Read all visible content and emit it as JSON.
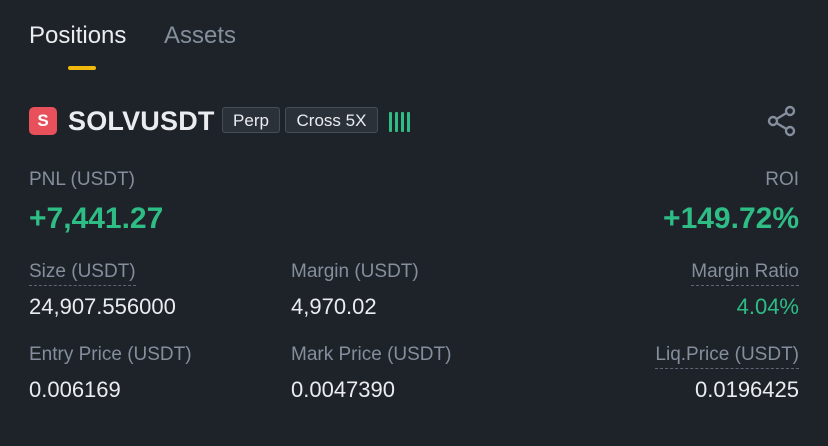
{
  "tabs": {
    "positions": "Positions",
    "assets": "Assets"
  },
  "position": {
    "logo_letter": "S",
    "symbol": "SOLVUSDT",
    "type_tag": "Perp",
    "margin_tag": "Cross 5X",
    "logo_color": "#e8505b",
    "accent_up": "#2ebd85",
    "tab_indicator_color": "#f0b90b",
    "share_icon": "share-icon",
    "signal_icon": "signal-bars-icon"
  },
  "pnl": {
    "label": "PNL (USDT)",
    "value": "+7,441.27"
  },
  "roi": {
    "label": "ROI",
    "value": "+149.72%"
  },
  "size": {
    "label": "Size (USDT)",
    "value": "24,907.556000"
  },
  "margin": {
    "label": "Margin (USDT)",
    "value": "4,970.02"
  },
  "margin_ratio": {
    "label": "Margin Ratio",
    "value": "4.04%"
  },
  "entry_price": {
    "label": "Entry Price (USDT)",
    "value": "0.006169"
  },
  "mark_price": {
    "label": "Mark Price (USDT)",
    "value": "0.0047390"
  },
  "liq_price": {
    "label": "Liq.Price (USDT)",
    "value": "0.0196425"
  }
}
